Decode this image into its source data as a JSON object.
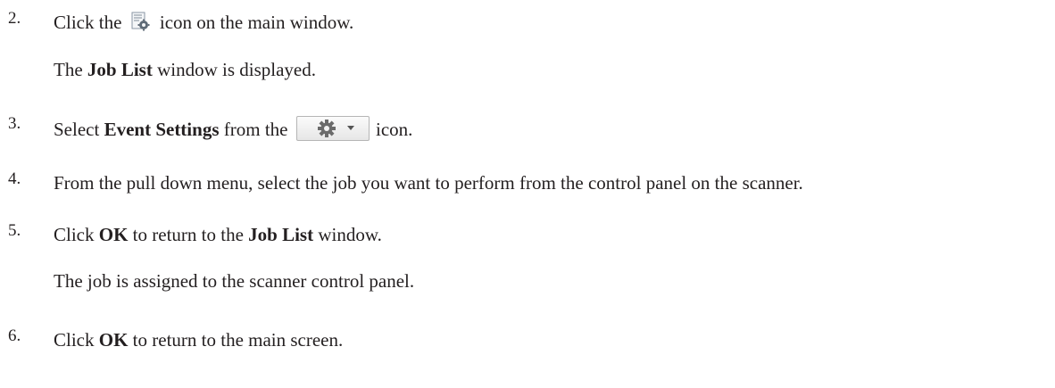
{
  "steps": [
    {
      "number": "2.",
      "parts": {
        "pre": "Click the",
        "post": "icon on the main window."
      },
      "icon": "job-settings-document-icon",
      "note": {
        "bold": "Job List",
        "rest": "window is displayed.",
        "prefix": "The"
      }
    },
    {
      "number": "3.",
      "parts": {
        "pre": "Select",
        "bold": "Event Settings",
        "mid": "from the",
        "post": "icon."
      },
      "icon": "gear-dropdown-icon"
    },
    {
      "number": "4.",
      "text": "From the pull down menu, select the job you want to perform from the control panel on the scanner."
    },
    {
      "number": "5.",
      "parts": {
        "pre": "Click",
        "bold1": "OK",
        "mid": "to return to the",
        "bold2": "Job List",
        "post": "window."
      },
      "note": {
        "text": "The job is assigned to the scanner control panel."
      }
    },
    {
      "number": "6.",
      "parts": {
        "pre": "Click",
        "bold": "OK",
        "post": "to return to the main screen."
      }
    }
  ],
  "colors": {
    "text": "#231f20",
    "icon_border": "#b5b5b5"
  }
}
